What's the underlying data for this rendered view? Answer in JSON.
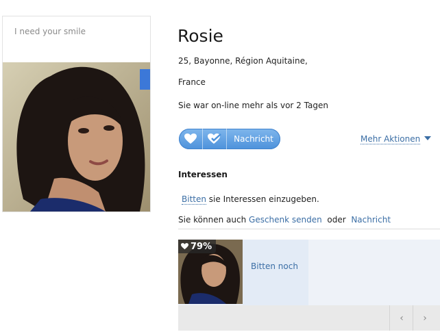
{
  "profile": {
    "tagline": "I need your smile",
    "name": "Rosie",
    "location": "25,  Bayonne, Région Aquitaine,",
    "country": "France",
    "online_status": "Sie war on-line mehr als vor 2 Tagen"
  },
  "actions": {
    "message_label": "Nachricht",
    "more_actions_label": "Mehr Aktionen"
  },
  "interests": {
    "heading": "Interessen",
    "ask_link": "Bitten",
    "ask_text": " sie Interessen einzugeben.",
    "also_prefix": "Sie können auch ",
    "gift_link": "Geschenk senden",
    "or_text": "oder",
    "message_link": "Nachricht"
  },
  "match": {
    "percent": "79%",
    "ask_more_label": "Bitten noch"
  },
  "nav": {
    "prev_label": "‹",
    "next_label": "›"
  },
  "colors": {
    "link": "#3b6ea5",
    "button": "#4d92db"
  }
}
